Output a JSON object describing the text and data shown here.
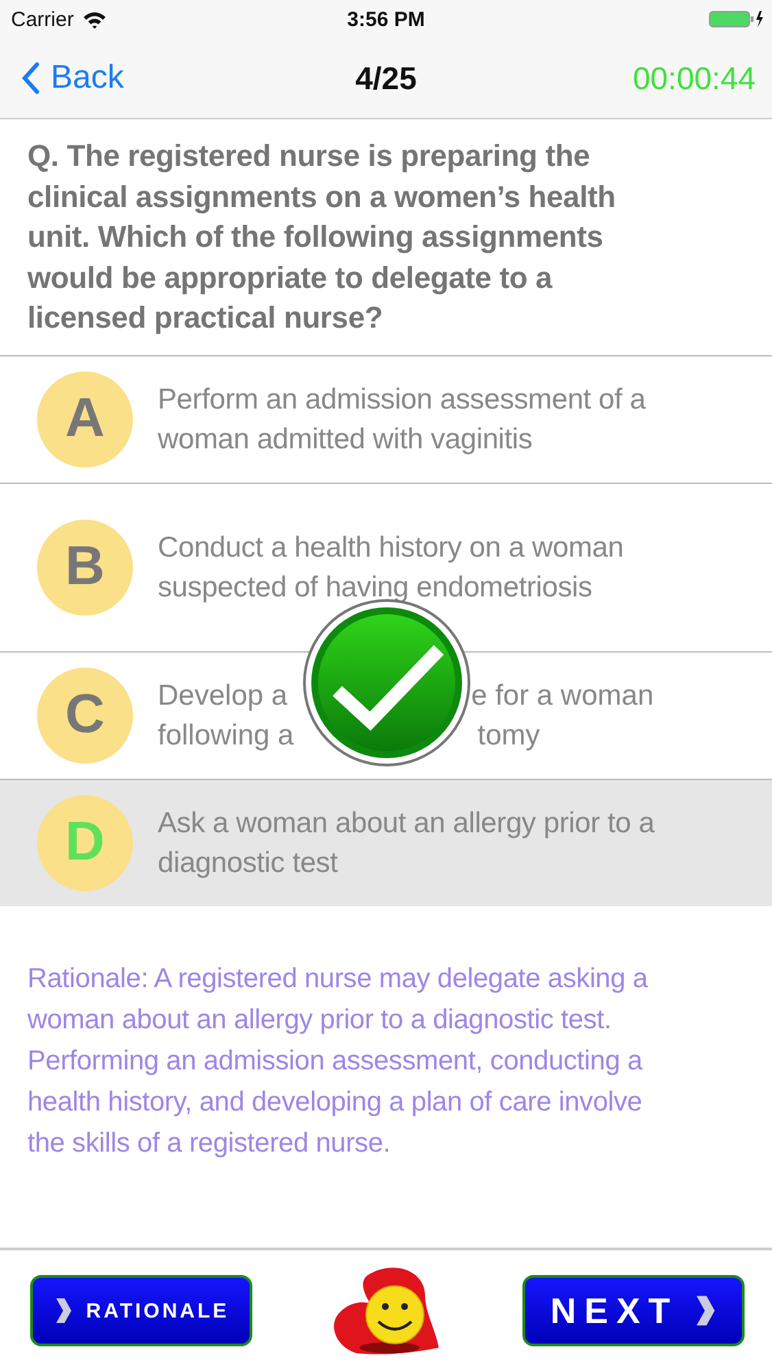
{
  "status_bar": {
    "carrier": "Carrier",
    "time": "3:56 PM"
  },
  "nav": {
    "back": "Back",
    "title": "4/25",
    "timer": "00:00:44"
  },
  "question": "Q. The registered nurse is preparing the clinical assignments on a women’s health unit. Which of the following assignments would be appropriate to delegate to a licensed practical nurse?",
  "options": [
    {
      "letter": "A",
      "kind": "text",
      "text": "Perform an admission assessment of a woman admitted with vaginitis",
      "selected": false
    },
    {
      "letter": "B",
      "kind": "text",
      "text": "Conduct a health history on a woman suspected of having endometriosis",
      "selected": false
    },
    {
      "letter": "C",
      "kind": "covered",
      "lines": [
        {
          "left": "Develop a",
          "right": "e for a woman"
        },
        {
          "left": "following a",
          "right": "tomy"
        }
      ],
      "selected": false
    },
    {
      "letter": "D",
      "kind": "text",
      "text": "Ask a woman about an allergy prior to a diagnostic test",
      "selected": true
    }
  ],
  "rationale": "Rationale: A registered nurse may delegate asking a woman about an allergy prior to a diagnostic test. Performing an admission assessment, conducting a health history, and developing a plan of care involve the skills of a registered nurse.",
  "buttons": {
    "rationale": "RATIONALE",
    "next": "NEXT"
  }
}
